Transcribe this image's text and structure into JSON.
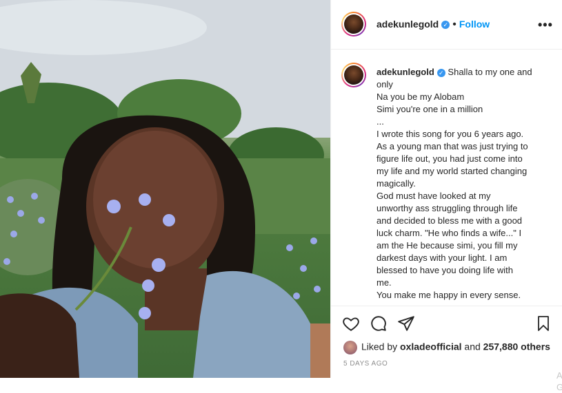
{
  "post": {
    "username": "adekunlegold",
    "verified_badge": "verified-icon",
    "follow_separator": "•",
    "follow_label": "Follow",
    "more_label": "•••"
  },
  "caption": {
    "username": "adekunlegold",
    "lines": [
      "Shalla to my one and",
      "only",
      "Na you be my Alobam",
      "Simi you're one in a million",
      "...",
      "I wrote this song for you 6 years ago.",
      "As a young man that was just trying to",
      "figure life out, you had just come into",
      "my life and my world started changing",
      "magically.",
      "God must have looked at my",
      "unworthy ass struggling through life",
      "and decided to bless me with a good",
      "luck charm. \"He who finds a wife...\" I",
      "am the He because simi, you fill my",
      "darkest days with your light. I am",
      "blessed to have you doing life with",
      "me.",
      "You make me happy in every sense."
    ]
  },
  "likes": {
    "prefix": "Liked by",
    "liker": "oxladeofficial",
    "and": "and",
    "others": "257,880 others"
  },
  "time_ago": "5 DAYS AGO",
  "watermark": {
    "line1": "A",
    "line2": "Go"
  },
  "icons": {
    "like": "heart-icon",
    "comment": "comment-icon",
    "share": "paper-plane-icon",
    "save": "bookmark-icon",
    "more": "more-icon"
  },
  "colors": {
    "accent": "#0095f6",
    "text": "#262626",
    "muted": "#8e8e8e"
  }
}
